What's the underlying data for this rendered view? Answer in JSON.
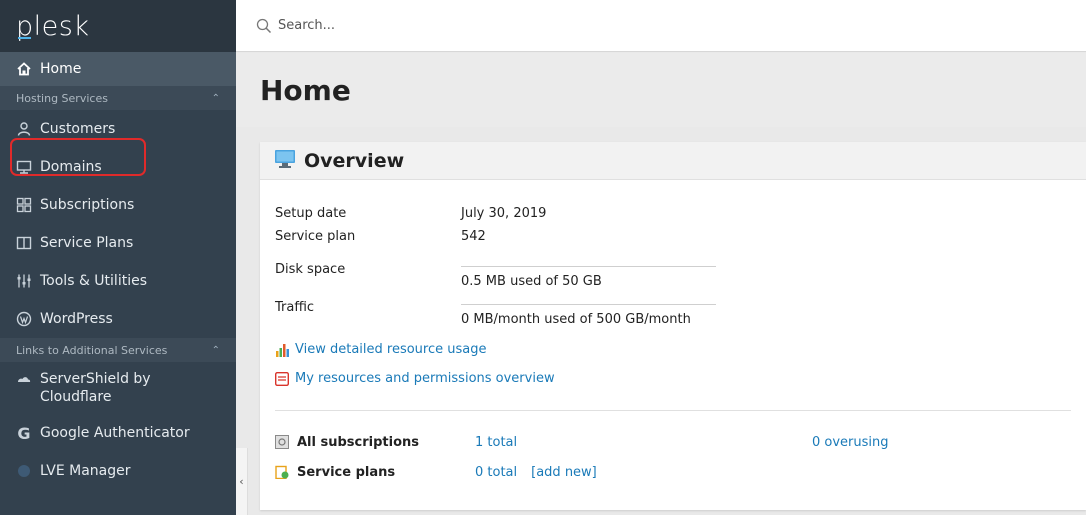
{
  "sidebar": {
    "logo": "plesk",
    "home": "Home",
    "section_hosting": "Hosting Services",
    "items": [
      {
        "label": "Customers",
        "icon": "user-icon"
      },
      {
        "label": "Domains",
        "icon": "monitor-icon"
      },
      {
        "label": "Subscriptions",
        "icon": "grid-icon"
      },
      {
        "label": "Service Plans",
        "icon": "book-icon"
      },
      {
        "label": "Tools & Utilities",
        "icon": "sliders-icon"
      },
      {
        "label": "WordPress",
        "icon": "wordpress-icon"
      }
    ],
    "section_links": "Links to Additional Services",
    "links": [
      {
        "label": "ServerShield by Cloudflare",
        "icon": "cloud-icon"
      },
      {
        "label": "Google Authenticator",
        "icon": "google-icon"
      },
      {
        "label": "LVE Manager",
        "icon": "lve-icon"
      }
    ],
    "collapse_glyph": "‹"
  },
  "search": {
    "placeholder": "Search..."
  },
  "page": {
    "title": "Home"
  },
  "overview": {
    "title": "Overview",
    "setup_date_label": "Setup date",
    "setup_date": "July 30, 2019",
    "service_plan_label": "Service plan",
    "service_plan": "542",
    "disk_space_label": "Disk space",
    "disk_space": "0.5 MB used of 50 GB",
    "traffic_label": "Traffic",
    "traffic": "0 MB/month used of 500 GB/month",
    "link_resource_usage": "View detailed resource usage",
    "link_permissions": "My resources and permissions overview",
    "all_subscriptions_label": "All subscriptions",
    "all_subscriptions_total": "1 total",
    "all_subscriptions_overusing": "0 overusing",
    "service_plans_label": "Service plans",
    "service_plans_total": "0 total",
    "service_plans_add": "[add new]"
  },
  "colors": {
    "sidebar": "#33414e",
    "sidebar_active": "#4a5966",
    "link": "#1a7ab8",
    "highlight": "#e02a2a"
  }
}
